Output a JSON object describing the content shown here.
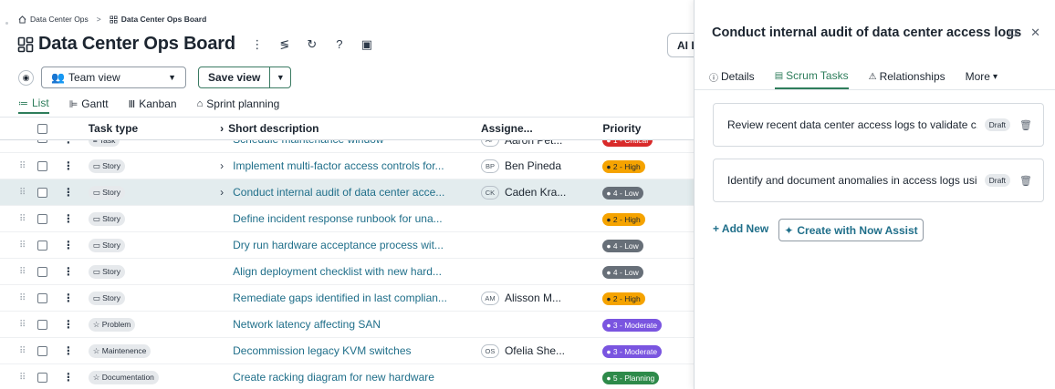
{
  "breadcrumb": {
    "parent": "Data Center Ops",
    "current": "Data Center Ops Board",
    "separator": ">"
  },
  "board": {
    "title": "Data Center Ops Board",
    "ai_button_label": "AI L"
  },
  "view": {
    "team_view": "Team view",
    "save_view": "Save view"
  },
  "tabs": [
    {
      "label": "List",
      "icon": "list-icon",
      "active": true
    },
    {
      "label": "Gantt",
      "icon": "gantt-icon",
      "active": false
    },
    {
      "label": "Kanban",
      "icon": "kanban-icon",
      "active": false
    },
    {
      "label": "Sprint planning",
      "icon": "sprint-planning-icon",
      "active": false
    }
  ],
  "table": {
    "headers": {
      "task_type": "Task type",
      "short_description": "Short description",
      "assignee": "Assigne...",
      "priority": "Priority"
    },
    "rows": [
      {
        "type": "Task",
        "desc": "Schedule maintenance window",
        "link": true,
        "caret": false,
        "initials": "AP",
        "assignee": "Aaron Pet...",
        "priority": "1 - Critical",
        "prio_class": "p1",
        "partial": true
      },
      {
        "type": "Story",
        "desc": "Implement multi-factor access controls for...",
        "link": false,
        "caret": true,
        "initials": "BP",
        "assignee": "Ben Pineda",
        "priority": "2 - High",
        "prio_class": "p2"
      },
      {
        "type": "Story",
        "desc": "Conduct internal audit of data center acce...",
        "link": false,
        "caret": true,
        "initials": "CK",
        "assignee": "Caden Kra...",
        "priority": "4 - Low",
        "prio_class": "p4",
        "selected": true
      },
      {
        "type": "Story",
        "desc": "Define incident response runbook for una...",
        "link": true,
        "caret": false,
        "initials": "",
        "assignee": "",
        "priority": "2 - High",
        "prio_class": "p2"
      },
      {
        "type": "Story",
        "desc": "Dry run hardware acceptance process wit...",
        "link": true,
        "caret": false,
        "initials": "",
        "assignee": "",
        "priority": "4 - Low",
        "prio_class": "p4"
      },
      {
        "type": "Story",
        "desc": "Align deployment checklist with new hard...",
        "link": true,
        "caret": false,
        "initials": "",
        "assignee": "",
        "priority": "4 - Low",
        "prio_class": "p4"
      },
      {
        "type": "Story",
        "desc": "Remediate gaps identified in last complian...",
        "link": true,
        "caret": false,
        "initials": "AM",
        "assignee": "Alisson M...",
        "priority": "2 - High",
        "prio_class": "p2"
      },
      {
        "type": "Problem",
        "desc": "Network latency affecting SAN",
        "link": true,
        "caret": false,
        "initials": "",
        "assignee": "",
        "priority": "3 - Moderate",
        "prio_class": "p3"
      },
      {
        "type": "Maintenence",
        "desc": "Decommission legacy KVM switches",
        "link": true,
        "caret": false,
        "initials": "OS",
        "assignee": "Ofelia She...",
        "priority": "3 - Moderate",
        "prio_class": "p3"
      },
      {
        "type": "Documentation",
        "desc": "Create racking diagram for new hardware",
        "link": true,
        "caret": false,
        "initials": "",
        "assignee": "",
        "priority": "5 - Planning",
        "prio_class": "p5"
      }
    ]
  },
  "panel": {
    "title": "Conduct internal audit of data center access logs",
    "tabs": [
      {
        "label": "Details",
        "icon": "info-icon",
        "active": false
      },
      {
        "label": "Scrum Tasks",
        "icon": "task-list-icon",
        "active": true
      },
      {
        "label": "Relationships",
        "icon": "relationships-icon",
        "active": false
      },
      {
        "label": "More",
        "icon": "caret-down-icon",
        "active": false
      }
    ],
    "tasks": [
      {
        "text": "Review recent data center access logs to validate c...",
        "status": "Draft"
      },
      {
        "text": "Identify and document anomalies in access logs usi...",
        "status": "Draft"
      }
    ],
    "add_new": "+ Add New",
    "create_label": "Create with Now Assist"
  },
  "colors": {
    "accent_green": "#2e7d5b",
    "link_blue": "#206f8a",
    "selected_row": "#e3ecee"
  }
}
